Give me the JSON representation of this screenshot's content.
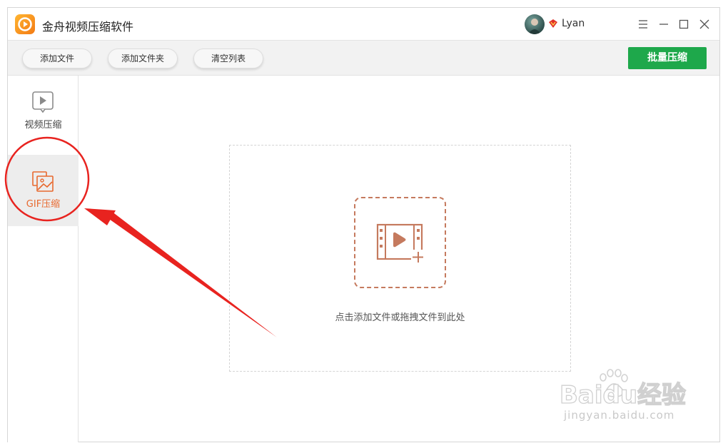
{
  "titlebar": {
    "app_title": "金舟视频压缩软件",
    "username": "Lyan"
  },
  "toolbar": {
    "add_file": "添加文件",
    "add_folder": "添加文件夹",
    "clear_list": "清空列表",
    "batch_compress": "批量压缩"
  },
  "sidebar": {
    "items": [
      {
        "label": "视频压缩",
        "active": false
      },
      {
        "label": "GIF压缩",
        "active": true
      }
    ]
  },
  "dropzone": {
    "hint": "点击添加文件或拖拽文件到此处"
  },
  "watermark": {
    "brand": "Baidu经验",
    "url": "jingyan.baidu.com"
  },
  "colors": {
    "accent_green": "#1ea84b",
    "active_orange": "#e8692f",
    "annotation_red": "#e8231f",
    "upload_border": "#c57a5e"
  }
}
